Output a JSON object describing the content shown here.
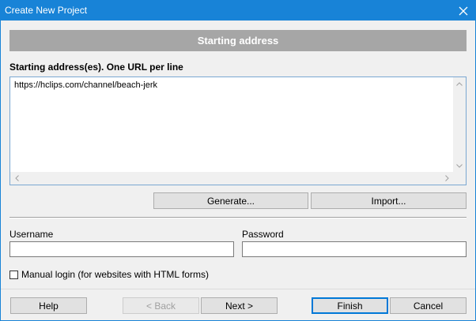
{
  "window": {
    "title": "Create New Project"
  },
  "header": {
    "section_title": "Starting address"
  },
  "urls": {
    "label": "Starting address(es). One URL per line",
    "value": "https://hclips.com/channel/beach-jerk"
  },
  "buttons": {
    "generate": "Generate...",
    "import": "Import...",
    "help": "Help",
    "back": "< Back",
    "next": "Next >",
    "finish": "Finish",
    "cancel": "Cancel"
  },
  "login": {
    "username_label": "Username",
    "username_value": "",
    "password_label": "Password",
    "password_value": "",
    "manual_login_label": "Manual login (for websites with HTML forms)",
    "manual_login_checked": false
  },
  "colors": {
    "titlebar": "#1883d7",
    "section_header": "#a6a6a6",
    "accent": "#0078d7"
  }
}
